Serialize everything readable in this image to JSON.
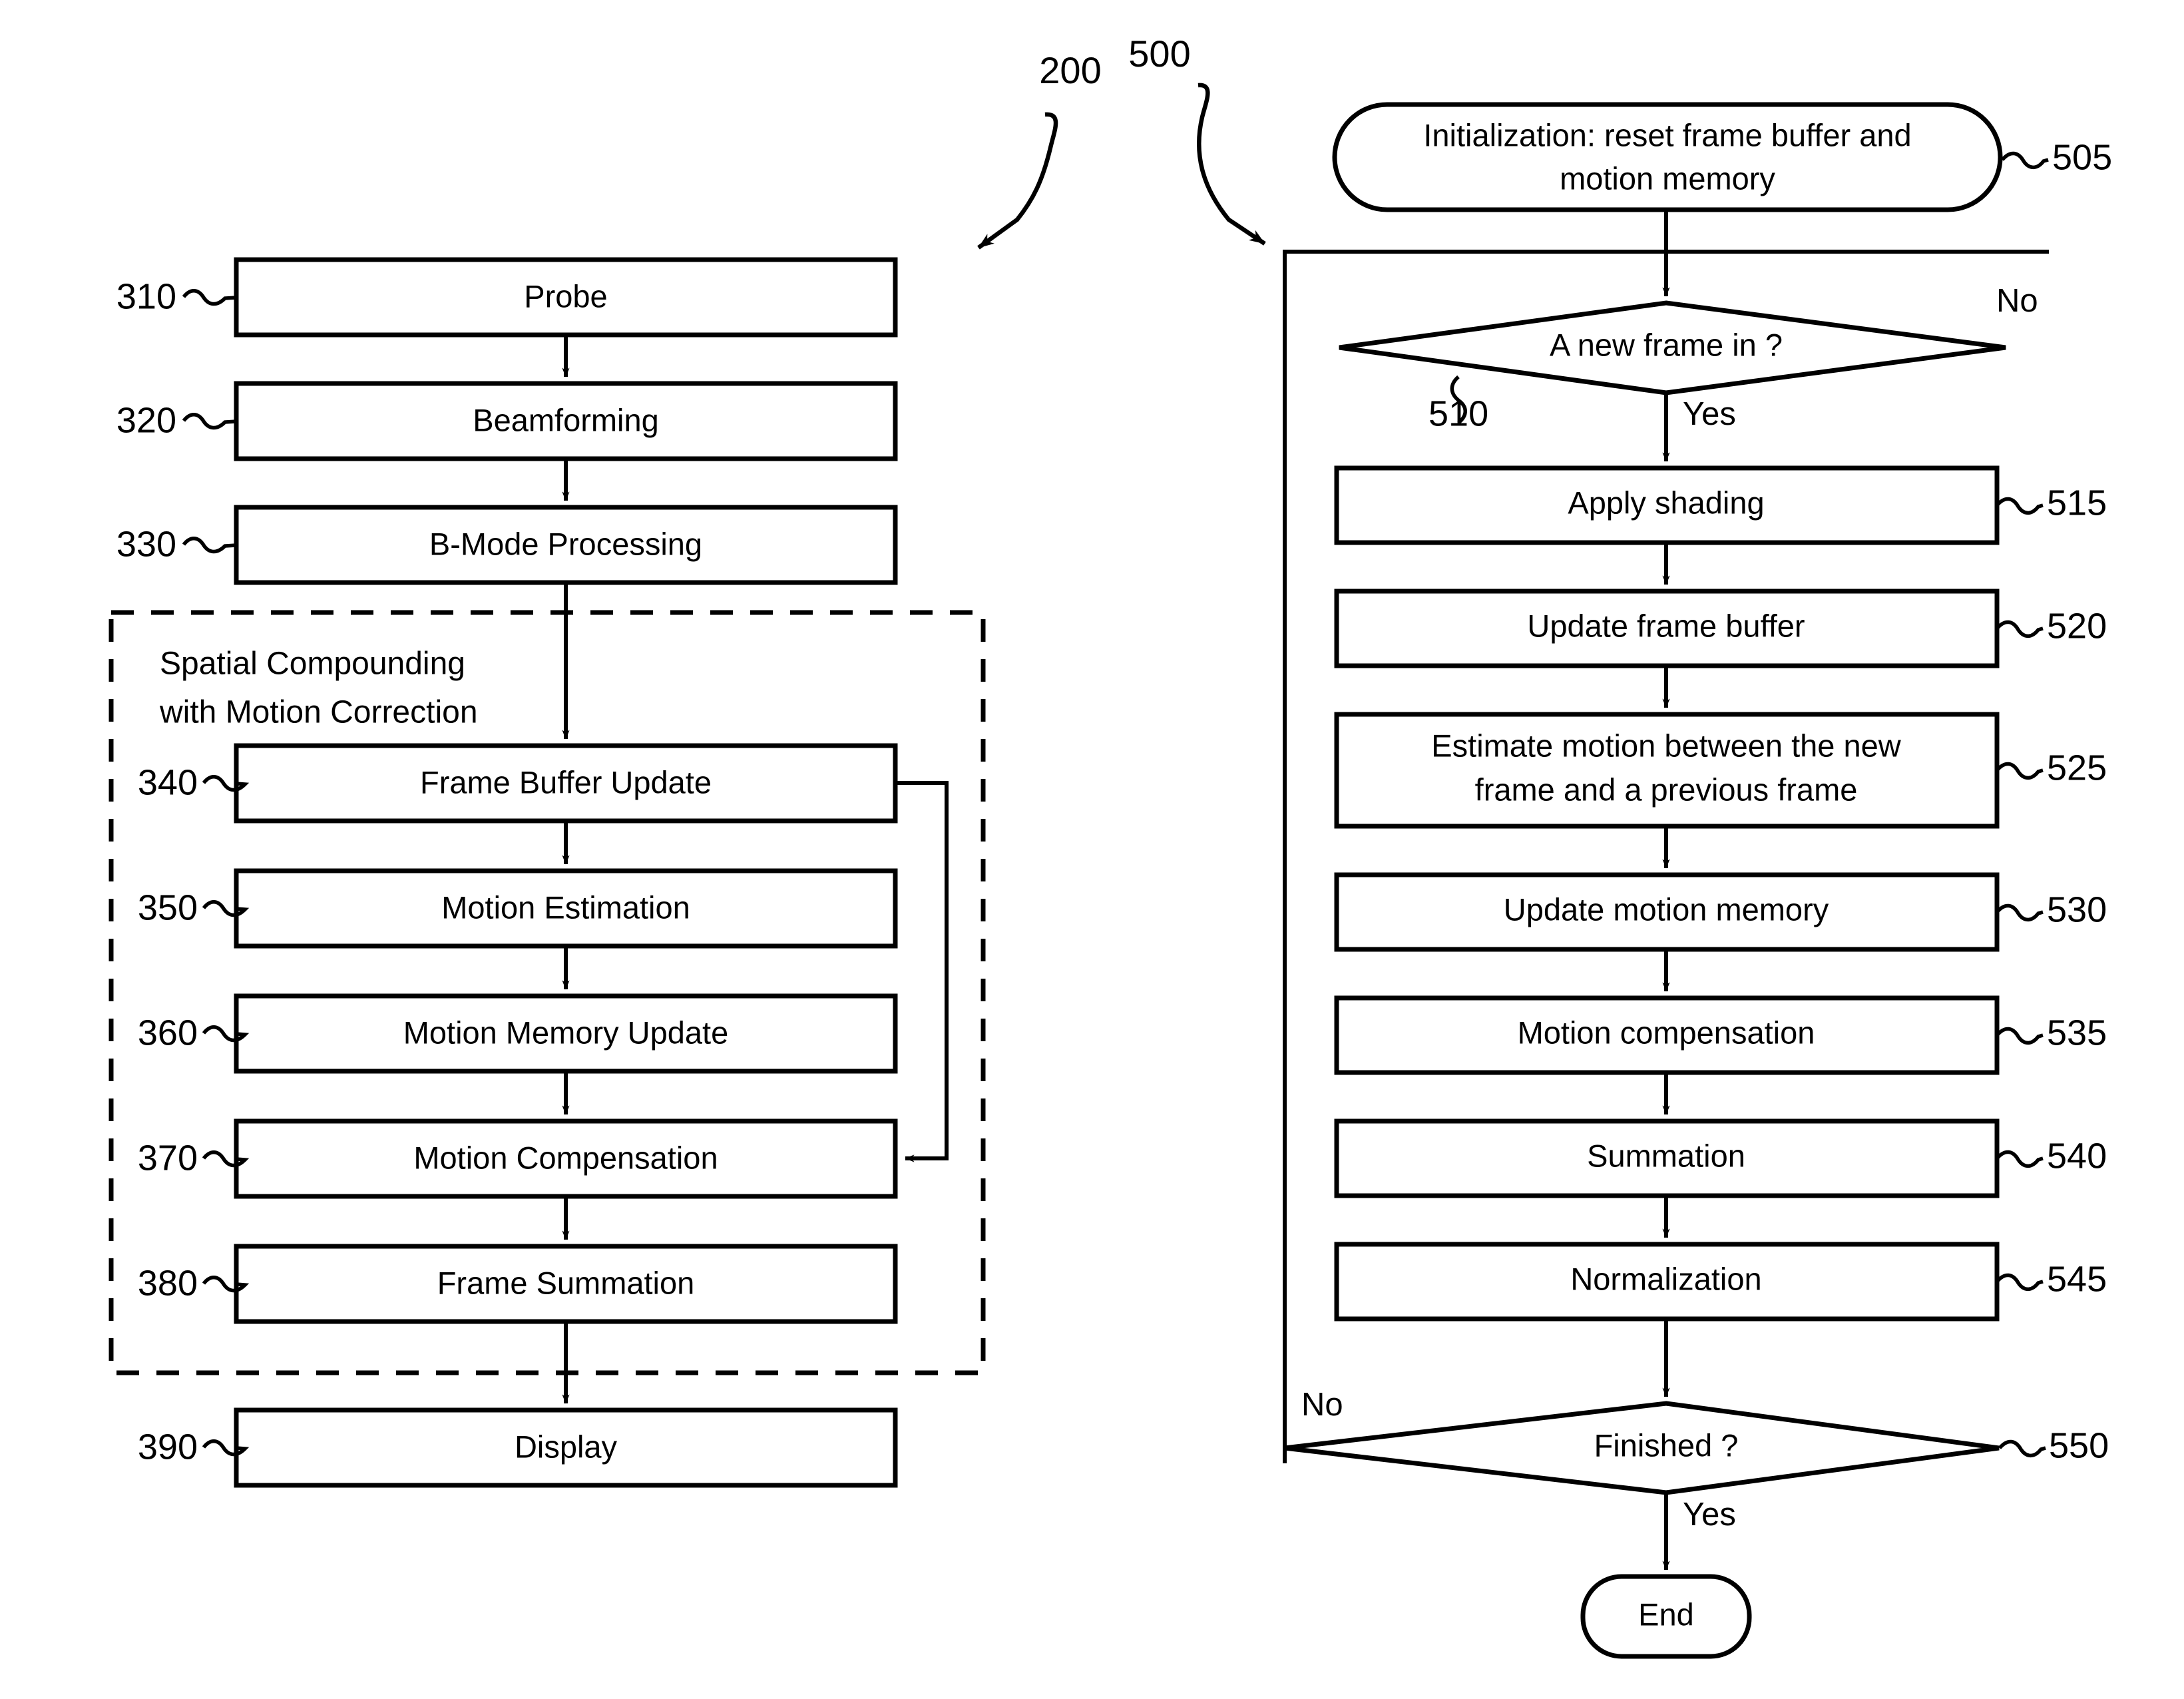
{
  "figure": {
    "left_flow_ref": "200",
    "right_flow_ref": "500"
  },
  "left_flow": {
    "group_title_line1": "Spatial Compounding",
    "group_title_line2": "with Motion Correction",
    "steps": [
      {
        "ref": "310",
        "label": "Probe"
      },
      {
        "ref": "320",
        "label": "Beamforming"
      },
      {
        "ref": "330",
        "label": "B-Mode Processing"
      },
      {
        "ref": "340",
        "label": "Frame Buffer Update"
      },
      {
        "ref": "350",
        "label": "Motion Estimation"
      },
      {
        "ref": "360",
        "label": "Motion Memory Update"
      },
      {
        "ref": "370",
        "label": "Motion Compensation"
      },
      {
        "ref": "380",
        "label": "Frame Summation"
      },
      {
        "ref": "390",
        "label": "Display"
      }
    ]
  },
  "right_flow": {
    "start": {
      "ref": "505",
      "label_line1": "Initialization: reset frame buffer and",
      "label_line2": "motion memory"
    },
    "decision_new_frame": {
      "ref": "510",
      "label": "A new frame in ?",
      "yes_label": "Yes",
      "no_label": "No"
    },
    "steps": [
      {
        "ref": "515",
        "label": "Apply shading"
      },
      {
        "ref": "520",
        "label": "Update frame buffer"
      },
      {
        "ref": "525",
        "label_line1": "Estimate motion between the new",
        "label_line2": "frame and a previous frame"
      },
      {
        "ref": "530",
        "label": "Update motion memory"
      },
      {
        "ref": "535",
        "label": "Motion compensation"
      },
      {
        "ref": "540",
        "label": "Summation"
      },
      {
        "ref": "545",
        "label": "Normalization"
      }
    ],
    "decision_finished": {
      "ref": "550",
      "label": "Finished ?",
      "yes_label": "Yes",
      "no_label": "No"
    },
    "end": {
      "label": "End"
    }
  }
}
